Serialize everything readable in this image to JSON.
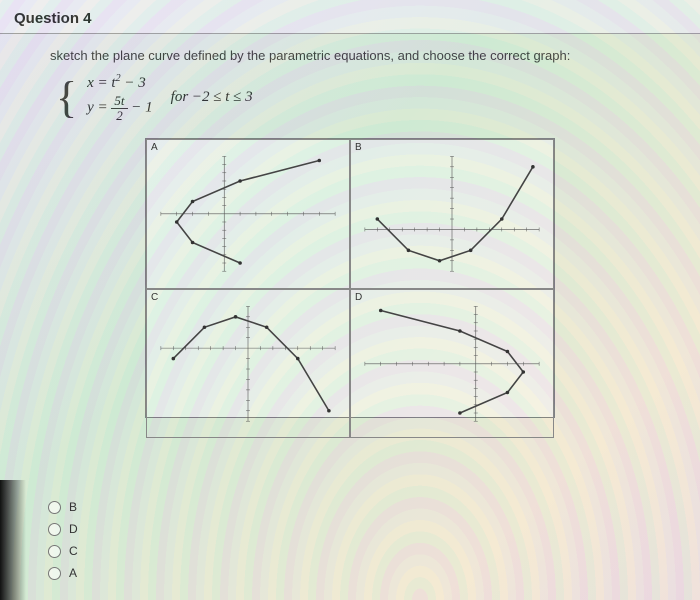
{
  "header": {
    "qnum": "Question 4"
  },
  "prompt": "sketch the plane curve defined by the parametric equations, and choose the correct graph:",
  "equations": {
    "line1_lhs": "x = t",
    "line1_sup": "2",
    "line1_tail": " − 3",
    "line2_lhs": "y = ",
    "frac_num": "5t",
    "frac_den": "2",
    "line2_tail": " − 1",
    "for": "for  −2 ≤ t ≤ 3"
  },
  "panels": {
    "A": "A",
    "B": "B",
    "C": "C",
    "D": "D"
  },
  "choices": [
    "B",
    "D",
    "C",
    "A"
  ],
  "chart_data": [
    {
      "type": "line",
      "panel": "A",
      "title": "",
      "xlabel": "",
      "ylabel": "",
      "xlim": [
        -4,
        7
      ],
      "ylim": [
        -7,
        7
      ],
      "series": [
        {
          "name": "curve",
          "x": [
            1,
            -2,
            -3,
            -2,
            1,
            6
          ],
          "y": [
            -6,
            -3.5,
            -1,
            1.5,
            4,
            6.5
          ]
        }
      ]
    },
    {
      "type": "line",
      "panel": "B",
      "title": "",
      "xlabel": "",
      "ylabel": "",
      "xlim": [
        -7,
        7
      ],
      "ylim": [
        -4,
        7
      ],
      "series": [
        {
          "name": "curve",
          "x": [
            -6,
            -3.5,
            -1,
            1.5,
            4,
            6.5
          ],
          "y": [
            1,
            -2,
            -3,
            -2,
            1,
            6
          ]
        }
      ]
    },
    {
      "type": "line",
      "panel": "C",
      "title": "",
      "xlabel": "",
      "ylabel": "",
      "xlim": [
        -7,
        7
      ],
      "ylim": [
        -7,
        4
      ],
      "series": [
        {
          "name": "curve",
          "x": [
            -6,
            -3.5,
            -1,
            1.5,
            4,
            6.5
          ],
          "y": [
            -1,
            2,
            3,
            2,
            -1,
            -6
          ]
        }
      ]
    },
    {
      "type": "line",
      "panel": "D",
      "title": "",
      "xlabel": "",
      "ylabel": "",
      "xlim": [
        -7,
        4
      ],
      "ylim": [
        -7,
        7
      ],
      "series": [
        {
          "name": "curve",
          "x": [
            -1,
            2,
            3,
            2,
            -1,
            -6
          ],
          "y": [
            -6,
            -3.5,
            -1,
            1.5,
            4,
            6.5
          ]
        }
      ]
    }
  ]
}
